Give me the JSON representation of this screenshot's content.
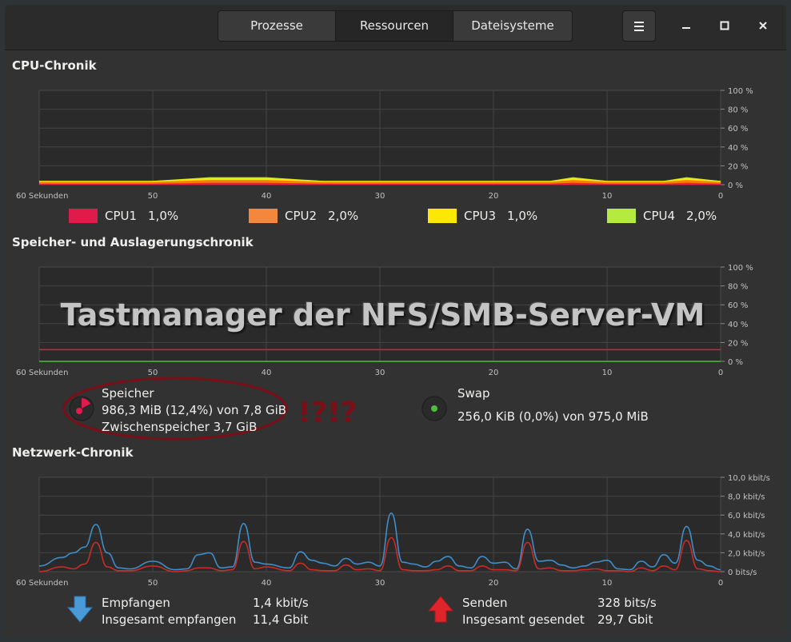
{
  "header": {
    "tabs": [
      {
        "label": "Prozesse"
      },
      {
        "label": "Ressourcen"
      },
      {
        "label": "Dateisysteme"
      }
    ],
    "active_tab": "Ressourcen",
    "menu_icon": "hamburger-icon",
    "min_icon": "minimize-icon",
    "max_icon": "maximize-icon",
    "close_icon": "close-icon"
  },
  "cpu": {
    "title": "CPU-Chronik",
    "x_ticks": [
      "60 Sekunden",
      "50",
      "40",
      "30",
      "20",
      "10",
      "0"
    ],
    "y_ticks": [
      "100 %",
      "80 %",
      "60 %",
      "40 %",
      "20 %",
      "0 %"
    ],
    "legend": [
      {
        "name": "CPU1",
        "value": "1,0%",
        "color": "#e01b4c"
      },
      {
        "name": "CPU2",
        "value": "2,0%",
        "color": "#f57900"
      },
      {
        "name": "CPU3",
        "value": "1,0%",
        "color": "#fce803"
      },
      {
        "name": "CPU4",
        "value": "2,0%",
        "color": "#b5ea3f"
      }
    ]
  },
  "memory": {
    "title": "Speicher- und Auslagerungschronik",
    "x_ticks": [
      "60 Sekunden",
      "50",
      "40",
      "30",
      "20",
      "10",
      "0"
    ],
    "y_ticks": [
      "100 %",
      "80 %",
      "60 %",
      "40 %",
      "20 %",
      "0 %"
    ],
    "ram": {
      "label": "Speicher",
      "usage": "986,3 MiB (12,4%) von 7,8 GiB",
      "cache": "Zwischenspeicher 3,7 GiB",
      "color": "#e01b4c"
    },
    "swap": {
      "label": "Swap",
      "usage": "256,0 KiB (0,0%) von 975,0 MiB",
      "color": "#4ebe3c"
    }
  },
  "overlay": {
    "title": "Tastmanager der NFS/SMB-Server-VM",
    "exclaim": "!?!?"
  },
  "network": {
    "title": "Netzwerk-Chronik",
    "x_ticks": [
      "60 Sekunden",
      "50",
      "40",
      "30",
      "20",
      "10",
      "0"
    ],
    "y_ticks": [
      "10,0 kbit/s",
      "8,0 kbit/s",
      "6,0 kbit/s",
      "4,0 kbit/s",
      "2,0 kbit/s",
      "0 bits/s"
    ],
    "receive": {
      "label": "Empfangen",
      "rate": "1,4 kbit/s",
      "total_label": "Insgesamt empfangen",
      "total": "11,4 Gbit",
      "icon": "download-arrow-icon"
    },
    "send": {
      "label": "Senden",
      "rate": "328 bits/s",
      "total_label": "Insgesamt gesendet",
      "total": "29,7 Gbit",
      "icon": "upload-arrow-icon"
    }
  },
  "chart_data": [
    {
      "type": "area",
      "title": "CPU-Chronik",
      "x": [
        60,
        55,
        50,
        45,
        40,
        35,
        30,
        25,
        20,
        15,
        13,
        10,
        5,
        3,
        0
      ],
      "ylim": [
        0,
        100
      ],
      "series": [
        {
          "name": "CPU1",
          "values": [
            1,
            1,
            1,
            2,
            2,
            1,
            1,
            1,
            1,
            1,
            2,
            1,
            1,
            2,
            1
          ]
        },
        {
          "name": "CPU2",
          "values": [
            2,
            2,
            2,
            3,
            3,
            2,
            2,
            2,
            2,
            2,
            3,
            2,
            2,
            3,
            2
          ]
        },
        {
          "name": "CPU3",
          "values": [
            1,
            1,
            1,
            2,
            2,
            1,
            1,
            1,
            1,
            1,
            2,
            1,
            1,
            2,
            1
          ]
        },
        {
          "name": "CPU4",
          "values": [
            0,
            0,
            0,
            1,
            1,
            0,
            0,
            0,
            0,
            0,
            1,
            0,
            0,
            1,
            0
          ]
        }
      ]
    },
    {
      "type": "line",
      "title": "Speicher- und Auslagerungschronik",
      "x": [
        60,
        0
      ],
      "ylim": [
        0,
        100
      ],
      "series": [
        {
          "name": "Speicher",
          "values": [
            12.4,
            12.4
          ]
        },
        {
          "name": "Swap",
          "values": [
            0,
            0
          ]
        }
      ]
    },
    {
      "type": "line",
      "title": "Netzwerk-Chronik",
      "x": [
        60,
        58,
        57,
        56,
        55,
        54,
        53,
        52,
        50,
        48,
        47,
        46,
        45,
        44,
        43,
        42,
        41,
        40,
        38,
        37,
        36,
        35,
        34,
        33,
        32,
        31,
        30,
        29,
        28,
        27,
        26,
        25,
        24,
        23,
        22,
        21,
        20,
        19,
        18,
        17,
        16,
        15,
        14,
        13,
        12,
        11,
        10,
        9,
        8,
        7,
        6,
        5,
        4,
        3,
        2,
        1,
        0
      ],
      "ylim": [
        0,
        10
      ],
      "series": [
        {
          "name": "Empfangen",
          "values": [
            0.6,
            1.5,
            2.0,
            2.6,
            5.0,
            2.0,
            0.4,
            0.3,
            1.1,
            0.2,
            0.3,
            1.8,
            2.0,
            0.4,
            0.5,
            5.1,
            1.0,
            0.8,
            0.4,
            2.1,
            1.2,
            0.9,
            0.6,
            1.4,
            0.8,
            1.0,
            0.6,
            6.2,
            1.0,
            0.8,
            0.5,
            1.1,
            1.6,
            0.6,
            0.4,
            1.6,
            0.9,
            1.0,
            0.3,
            4.5,
            1.1,
            1.2,
            0.7,
            0.4,
            0.6,
            1.0,
            1.2,
            0.3,
            0.2,
            1.1,
            0.5,
            1.8,
            0.9,
            4.8,
            1.2,
            0.6,
            0.2
          ]
        },
        {
          "name": "Senden",
          "values": [
            0.0,
            0.5,
            0.3,
            0.8,
            3.1,
            0.5,
            0.1,
            0.1,
            0.6,
            0.0,
            0.1,
            0.4,
            0.4,
            0.1,
            0.2,
            3.2,
            0.3,
            0.5,
            0.1,
            0.9,
            0.2,
            0.1,
            0.1,
            0.7,
            0.2,
            0.3,
            0.1,
            3.6,
            0.2,
            0.1,
            0.1,
            0.2,
            0.6,
            0.1,
            0.1,
            0.6,
            0.2,
            0.2,
            0.1,
            3.1,
            0.3,
            0.4,
            0.1,
            0.1,
            0.2,
            0.3,
            0.1,
            0.1,
            0.0,
            0.4,
            0.1,
            0.6,
            0.2,
            3.3,
            0.3,
            0.1,
            0.0
          ]
        }
      ]
    }
  ]
}
